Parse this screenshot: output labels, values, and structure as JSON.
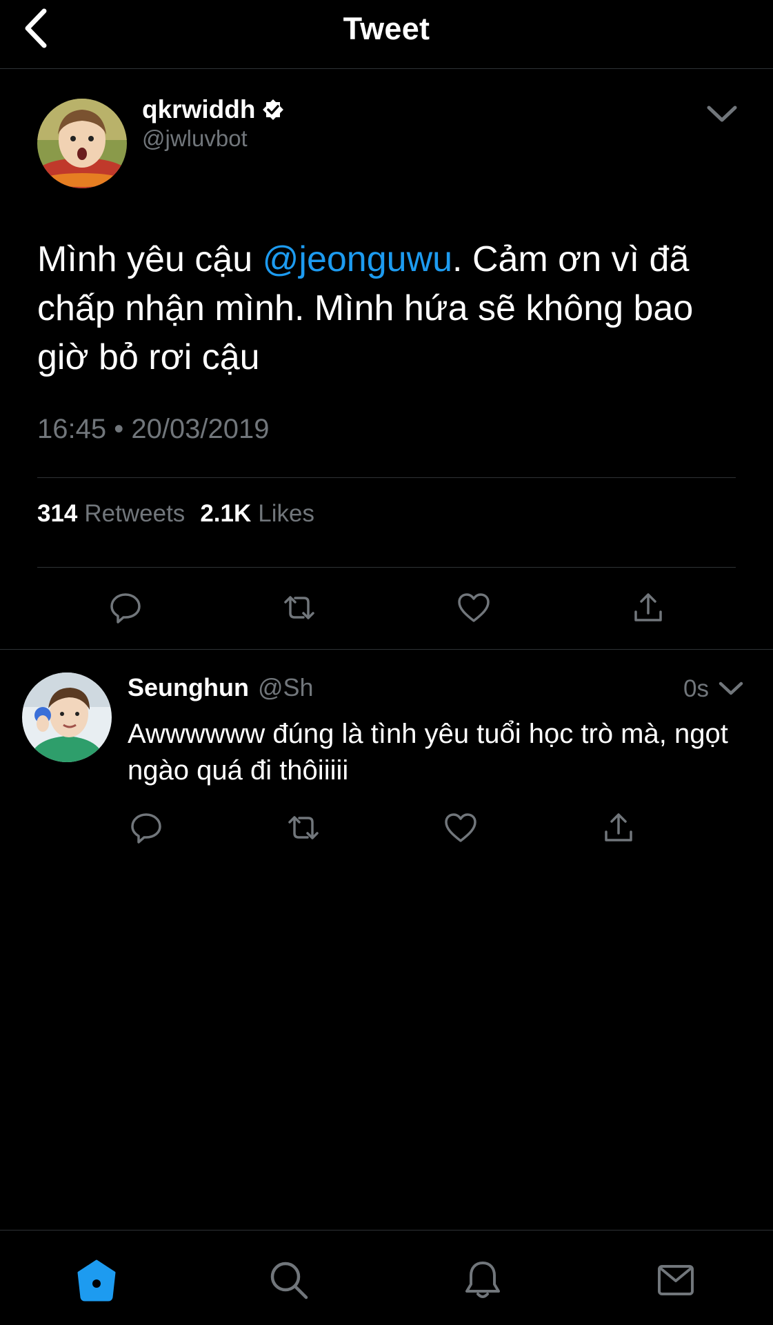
{
  "header": {
    "title": "Tweet",
    "back_icon": "chevron-left-icon"
  },
  "tweet": {
    "author": {
      "display_name": "qkrwiddh",
      "verified": true,
      "handle": "@jwluvbot"
    },
    "text_before_mention": "Mình yêu cậu ",
    "mention": "@jeonguwu",
    "text_after_mention": ". Cảm ơn vì đã chấp nhận mình. Mình hứa sẽ không bao giờ bỏ rơi cậu",
    "timestamp": "16:45 • 20/03/2019",
    "retweets_count": "314",
    "retweets_label": "Retweets",
    "likes_count": "2.1K",
    "likes_label": "Likes",
    "actions": [
      "reply-icon",
      "retweet-icon",
      "like-icon",
      "share-icon"
    ]
  },
  "reply": {
    "display_name": "Seunghun",
    "handle": "@Sh",
    "time": "0s",
    "text": "Awwwwww đúng là tình yêu tuổi học trò mà, ngọt ngào quá đi thôiiiii",
    "actions": [
      "reply-icon",
      "retweet-icon",
      "like-icon",
      "share-icon"
    ]
  },
  "bottom_nav": {
    "items": [
      "home-icon",
      "search-icon",
      "notifications-icon",
      "messages-icon"
    ],
    "active": "home-icon"
  },
  "colors": {
    "background": "#000000",
    "text_primary": "#ffffff",
    "text_secondary": "#71767b",
    "accent": "#1d9bf0",
    "divider": "#2f3336"
  }
}
